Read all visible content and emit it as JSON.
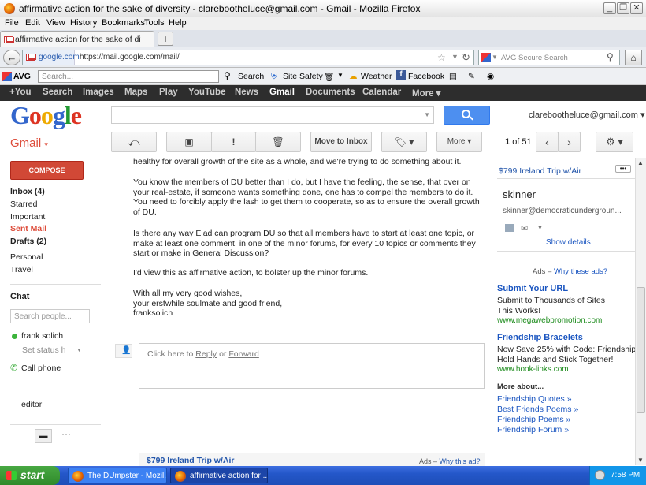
{
  "window": {
    "title": "affirmative action for the sake of diversity - clarebootheluce@gmail.com - Gmail - Mozilla Firefox"
  },
  "menu": [
    "File",
    "Edit",
    "View",
    "History",
    "Bookmarks",
    "Tools",
    "Help"
  ],
  "tab": {
    "label": "affirmative action for the sake of diversity - ...",
    "new": "+"
  },
  "nav": {
    "site": "google.com",
    "url": "https://mail.google.com/mail/",
    "search_placeholder": "AVG Secure Search"
  },
  "avg": {
    "brand": "AVG",
    "search_placeholder": "Search...",
    "search": "Search",
    "site_safety": "Site Safety",
    "weather": "Weather",
    "facebook": "Facebook"
  },
  "gbar": [
    "+You",
    "Search",
    "Images",
    "Maps",
    "Play",
    "YouTube",
    "News",
    "Gmail",
    "Documents",
    "Calendar",
    "More ▾"
  ],
  "google": {
    "logo": "Google",
    "account": "clarebootheluce@gmail.com"
  },
  "toolbar": {
    "gmail": "Gmail",
    "move_to_inbox": "Move to Inbox",
    "more": "More",
    "count_prefix": "1",
    "count_suffix": "of 51"
  },
  "leftnav": {
    "compose": "COMPOSE",
    "items": [
      "Inbox (4)",
      "Starred",
      "Important",
      "Sent Mail",
      "Drafts (2)",
      "Personal",
      "Travel"
    ],
    "chat": "Chat",
    "chat_search": "Search people...",
    "contact": "frank solich",
    "status": "Set status h",
    "call": "Call phone",
    "editor": "editor"
  },
  "message": {
    "p1": "healthy for overall growth of the site as a whole, and we're trying to do something about it.",
    "p2": "You know the members of DU better than I do, but I have the feeling, the sense, that over on your real-estate, if someone wants something done, one has to compel the members to do it. You need to forcibly apply the lash to get them to cooperate, so as to ensure the overall growth of DU.",
    "p3": "Is there any way Elad can program DU so that all members have to start at least one topic, or make at least one comment, in one of the minor forums, for every 10 topics or comments they start or make in General Discussion?",
    "p4": "I'd view this as affirmative action, to bolster up the minor forums.",
    "sig1": "With all my very good wishes,",
    "sig2": "your erstwhile soulmate and good friend,",
    "sig3": "franksolich",
    "reply_pre": "Click here to",
    "reply": "Reply",
    "or": "or",
    "forward": "Forward",
    "foot_ad": "$799 Ireland Trip w/Air",
    "foot_ads": "Ads –",
    "foot_why": "Why this ad?"
  },
  "right": {
    "top_ad": "$799 Ireland Trip w/Air",
    "name": "skinner",
    "email": "skinner@democraticundergroun...",
    "show_details": "Show details",
    "ads_label": "Ads –",
    "why": "Why these ads?",
    "ad1": {
      "title": "Submit Your URL",
      "line1": "Submit to Thousands of Sites",
      "line2": "This Works!",
      "url": "www.megawebpromotion.com"
    },
    "ad2": {
      "title": "Friendship Bracelets",
      "line1": "Now Save 25% with Code: Friendship.",
      "line2": "Hold Hands and Stick Together!",
      "url": "www.hook-links.com"
    },
    "more_about": "More about...",
    "links": [
      "Friendship Quotes »",
      "Best Friends Poems »",
      "Friendship Poems »",
      "Friendship Forum »"
    ]
  },
  "taskbar": {
    "start": "start",
    "task1": "The DUmpster - Mozil...",
    "task2": "affirmative action for ...",
    "clock": "7:58 PM"
  },
  "colors": {
    "compose": "#d14836",
    "search_btn": "#4d8ff0",
    "link": "#1a55c0",
    "ad_url": "#1a8a1a",
    "taskbar": "#2457c9",
    "start": "#3c9a36"
  }
}
